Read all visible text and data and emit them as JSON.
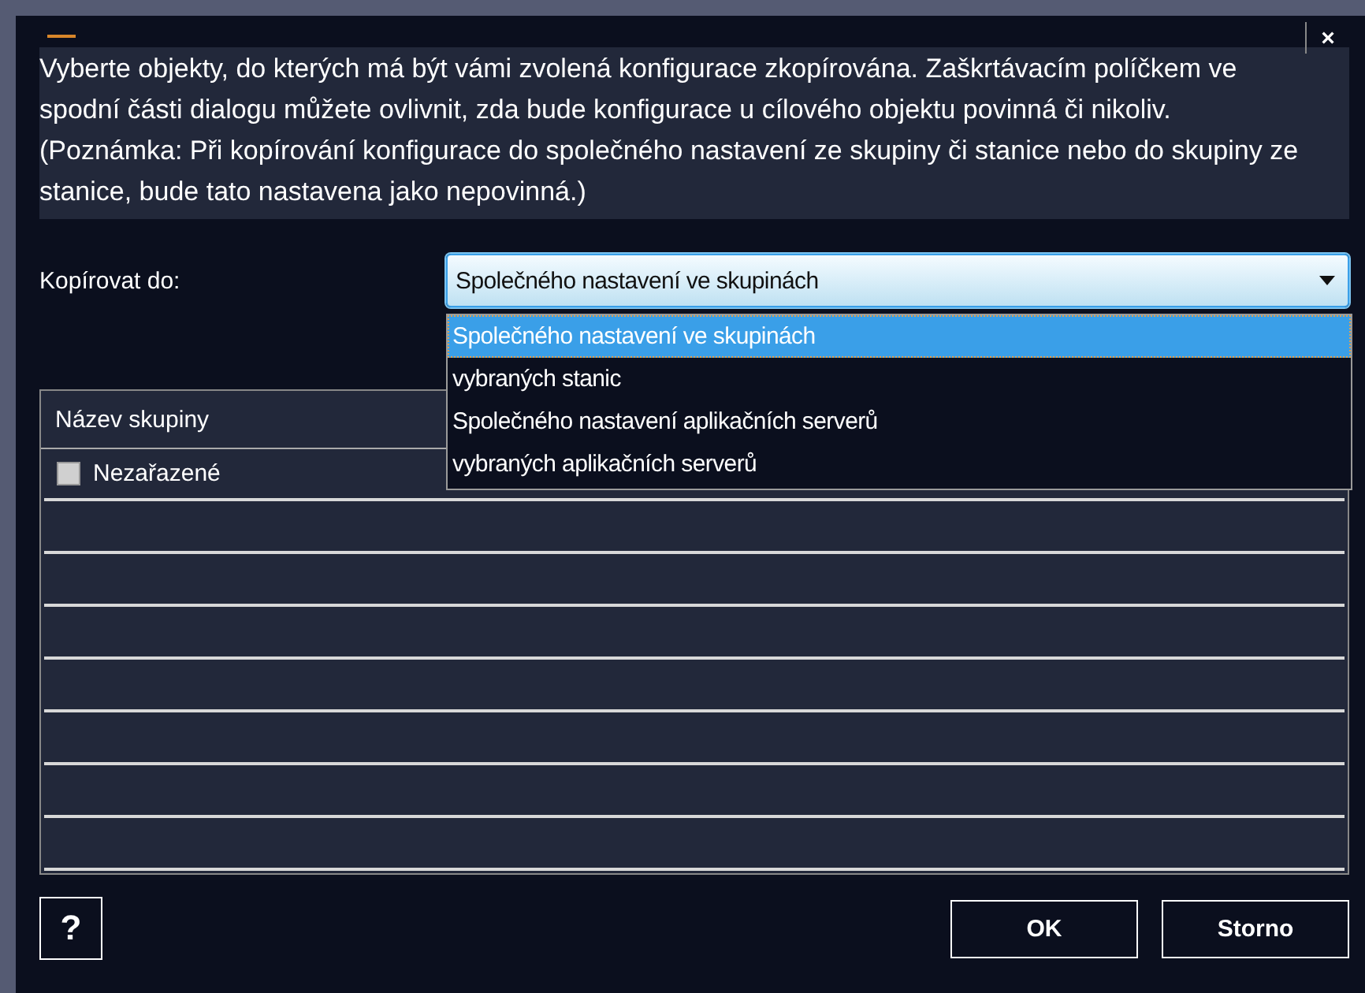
{
  "window": {
    "close": "×"
  },
  "description": "Vyberte objekty, do kterých má být vámi zvolená konfigurace zkopírována. Zaškrtávacím políčkem ve spodní části dialogu můžete ovlivnit, zda bude konfigurace u cílového objektu povinná či nikoliv. (Poznámka: Při kopírování konfigurace do společného nastavení ze skupiny či stanice nebo do skupiny ze stanice, bude tato nastavena jako nepovinná.)",
  "copy_to": {
    "label": "Kopírovat do:",
    "value": "Společného nastavení ve skupinách",
    "expanded": true,
    "options": [
      {
        "label": "Společného nastavení ve skupinách",
        "selected": true
      },
      {
        "label": "vybraných stanic",
        "selected": false
      },
      {
        "label": "Společného nastavení aplikačních serverů",
        "selected": false
      },
      {
        "label": "vybraných aplikačních serverů",
        "selected": false
      }
    ]
  },
  "table": {
    "columns": [
      "Název skupiny"
    ],
    "rows": [
      {
        "name": "Nezařazené",
        "checked": false
      }
    ]
  },
  "help": "?",
  "buttons": [
    "OK",
    "Storno"
  ]
}
